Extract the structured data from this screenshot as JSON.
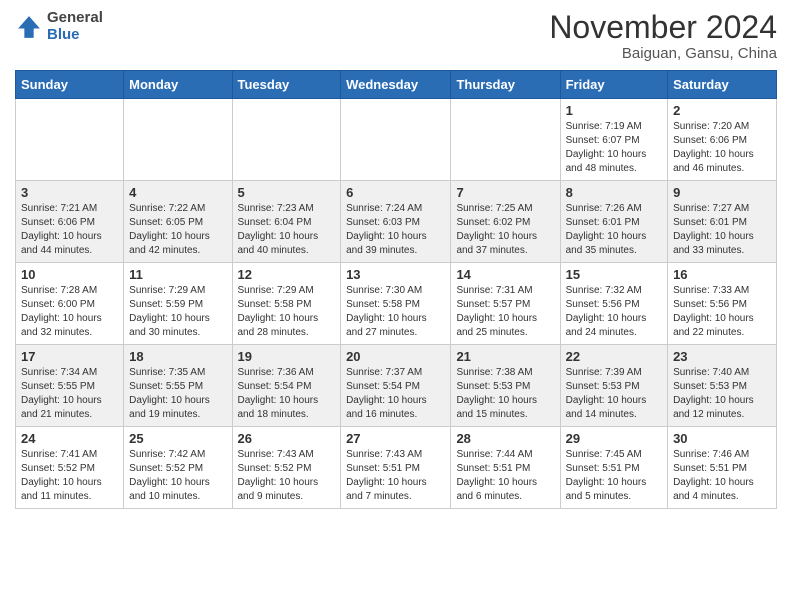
{
  "header": {
    "logo_general": "General",
    "logo_blue": "Blue",
    "month_title": "November 2024",
    "location": "Baiguan, Gansu, China"
  },
  "weekdays": [
    "Sunday",
    "Monday",
    "Tuesday",
    "Wednesday",
    "Thursday",
    "Friday",
    "Saturday"
  ],
  "weeks": [
    [
      {
        "day": "",
        "info": ""
      },
      {
        "day": "",
        "info": ""
      },
      {
        "day": "",
        "info": ""
      },
      {
        "day": "",
        "info": ""
      },
      {
        "day": "",
        "info": ""
      },
      {
        "day": "1",
        "info": "Sunrise: 7:19 AM\nSunset: 6:07 PM\nDaylight: 10 hours and 48 minutes."
      },
      {
        "day": "2",
        "info": "Sunrise: 7:20 AM\nSunset: 6:06 PM\nDaylight: 10 hours and 46 minutes."
      }
    ],
    [
      {
        "day": "3",
        "info": "Sunrise: 7:21 AM\nSunset: 6:06 PM\nDaylight: 10 hours and 44 minutes."
      },
      {
        "day": "4",
        "info": "Sunrise: 7:22 AM\nSunset: 6:05 PM\nDaylight: 10 hours and 42 minutes."
      },
      {
        "day": "5",
        "info": "Sunrise: 7:23 AM\nSunset: 6:04 PM\nDaylight: 10 hours and 40 minutes."
      },
      {
        "day": "6",
        "info": "Sunrise: 7:24 AM\nSunset: 6:03 PM\nDaylight: 10 hours and 39 minutes."
      },
      {
        "day": "7",
        "info": "Sunrise: 7:25 AM\nSunset: 6:02 PM\nDaylight: 10 hours and 37 minutes."
      },
      {
        "day": "8",
        "info": "Sunrise: 7:26 AM\nSunset: 6:01 PM\nDaylight: 10 hours and 35 minutes."
      },
      {
        "day": "9",
        "info": "Sunrise: 7:27 AM\nSunset: 6:01 PM\nDaylight: 10 hours and 33 minutes."
      }
    ],
    [
      {
        "day": "10",
        "info": "Sunrise: 7:28 AM\nSunset: 6:00 PM\nDaylight: 10 hours and 32 minutes."
      },
      {
        "day": "11",
        "info": "Sunrise: 7:29 AM\nSunset: 5:59 PM\nDaylight: 10 hours and 30 minutes."
      },
      {
        "day": "12",
        "info": "Sunrise: 7:29 AM\nSunset: 5:58 PM\nDaylight: 10 hours and 28 minutes."
      },
      {
        "day": "13",
        "info": "Sunrise: 7:30 AM\nSunset: 5:58 PM\nDaylight: 10 hours and 27 minutes."
      },
      {
        "day": "14",
        "info": "Sunrise: 7:31 AM\nSunset: 5:57 PM\nDaylight: 10 hours and 25 minutes."
      },
      {
        "day": "15",
        "info": "Sunrise: 7:32 AM\nSunset: 5:56 PM\nDaylight: 10 hours and 24 minutes."
      },
      {
        "day": "16",
        "info": "Sunrise: 7:33 AM\nSunset: 5:56 PM\nDaylight: 10 hours and 22 minutes."
      }
    ],
    [
      {
        "day": "17",
        "info": "Sunrise: 7:34 AM\nSunset: 5:55 PM\nDaylight: 10 hours and 21 minutes."
      },
      {
        "day": "18",
        "info": "Sunrise: 7:35 AM\nSunset: 5:55 PM\nDaylight: 10 hours and 19 minutes."
      },
      {
        "day": "19",
        "info": "Sunrise: 7:36 AM\nSunset: 5:54 PM\nDaylight: 10 hours and 18 minutes."
      },
      {
        "day": "20",
        "info": "Sunrise: 7:37 AM\nSunset: 5:54 PM\nDaylight: 10 hours and 16 minutes."
      },
      {
        "day": "21",
        "info": "Sunrise: 7:38 AM\nSunset: 5:53 PM\nDaylight: 10 hours and 15 minutes."
      },
      {
        "day": "22",
        "info": "Sunrise: 7:39 AM\nSunset: 5:53 PM\nDaylight: 10 hours and 14 minutes."
      },
      {
        "day": "23",
        "info": "Sunrise: 7:40 AM\nSunset: 5:53 PM\nDaylight: 10 hours and 12 minutes."
      }
    ],
    [
      {
        "day": "24",
        "info": "Sunrise: 7:41 AM\nSunset: 5:52 PM\nDaylight: 10 hours and 11 minutes."
      },
      {
        "day": "25",
        "info": "Sunrise: 7:42 AM\nSunset: 5:52 PM\nDaylight: 10 hours and 10 minutes."
      },
      {
        "day": "26",
        "info": "Sunrise: 7:43 AM\nSunset: 5:52 PM\nDaylight: 10 hours and 9 minutes."
      },
      {
        "day": "27",
        "info": "Sunrise: 7:43 AM\nSunset: 5:51 PM\nDaylight: 10 hours and 7 minutes."
      },
      {
        "day": "28",
        "info": "Sunrise: 7:44 AM\nSunset: 5:51 PM\nDaylight: 10 hours and 6 minutes."
      },
      {
        "day": "29",
        "info": "Sunrise: 7:45 AM\nSunset: 5:51 PM\nDaylight: 10 hours and 5 minutes."
      },
      {
        "day": "30",
        "info": "Sunrise: 7:46 AM\nSunset: 5:51 PM\nDaylight: 10 hours and 4 minutes."
      }
    ]
  ]
}
